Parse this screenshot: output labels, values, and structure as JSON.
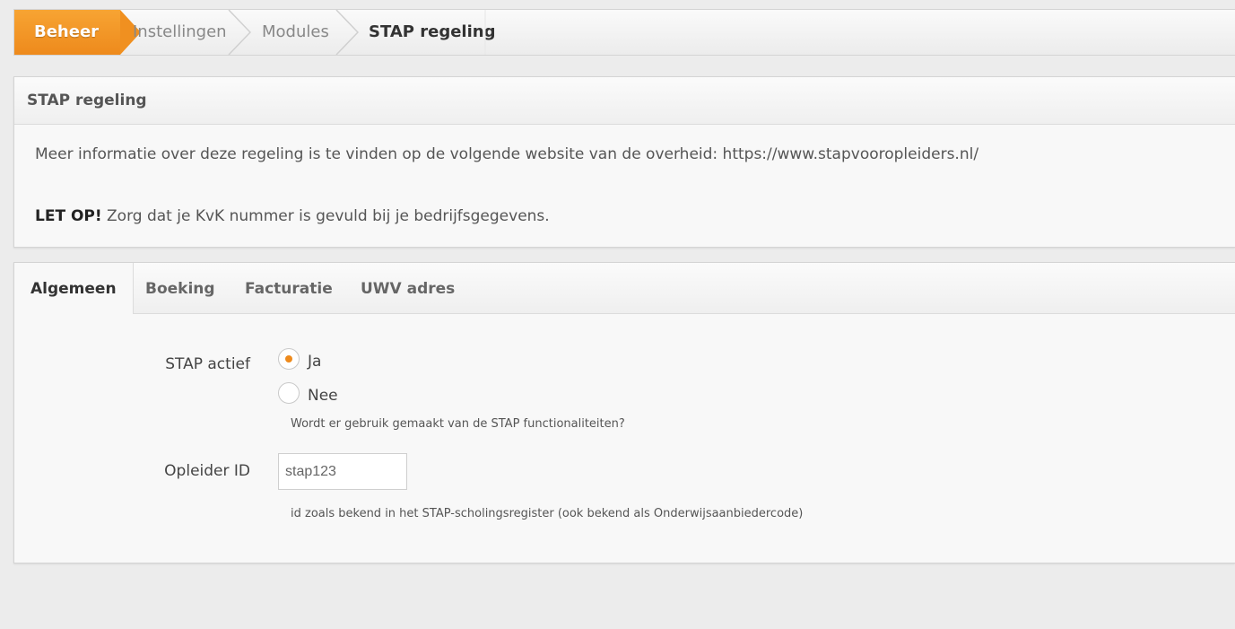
{
  "breadcrumb": {
    "items": [
      "Beheer",
      "Instellingen",
      "Modules",
      "STAP regeling"
    ]
  },
  "info_panel": {
    "title": "STAP regeling",
    "line1_text": "Meer informatie over deze regeling is te vinden op de volgende website van de overheid: https://www.stapvooropleiders.nl/",
    "line2_bold": "LET OP!",
    "line2_text": " Zorg dat je KvK nummer is gevuld bij je bedrijfsgegevens."
  },
  "tabs": [
    "Algemeen",
    "Boeking",
    "Facturatie",
    "UWV adres"
  ],
  "form": {
    "stap_actief_label": "STAP actief",
    "option_ja": "Ja",
    "option_nee": "Nee",
    "selected": "Ja",
    "stap_help": "Wordt er gebruik gemaakt van de STAP functionaliteiten?",
    "opleider_label": "Opleider ID",
    "opleider_value": "stap123",
    "opleider_help": "id zoals bekend in het STAP-scholingsregister (ook bekend als Onderwijsaanbiedercode)"
  },
  "colors": {
    "accent": "#ee8a1c",
    "background": "#ececec"
  }
}
